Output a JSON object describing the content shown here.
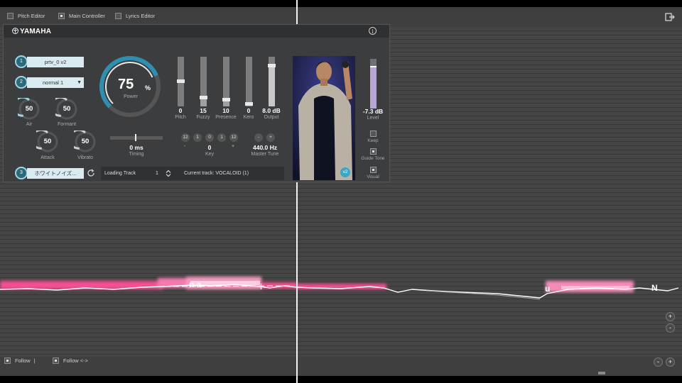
{
  "topbar": {
    "pitch_editor": "Pitch Editor",
    "main_controller": "Main Controller",
    "lyrics_editor": "Lyrics Editor"
  },
  "panel": {
    "brand": "YAMAHA",
    "info_symbol": "i",
    "voice_slot_1": {
      "num": "1",
      "value": "prtv_0 v2"
    },
    "voice_slot_2": {
      "num": "2",
      "value": "normal 1"
    },
    "voice_slot_3": {
      "num": "3",
      "value": "ホワイトノイズ..."
    },
    "knobs": {
      "air": {
        "value": "50",
        "label": "Air"
      },
      "formant": {
        "value": "50",
        "label": "Formant"
      },
      "attack": {
        "value": "50",
        "label": "Attack"
      },
      "vibrato": {
        "value": "50",
        "label": "Vibrato"
      }
    },
    "power": {
      "value": "75",
      "unit": "%",
      "label": "Power",
      "level": 0.75
    },
    "faders": {
      "pitch": {
        "value": "0",
        "label": "Pitch"
      },
      "fuzzy": {
        "value": "15",
        "label": "Fuzzy"
      },
      "presence": {
        "value": "10",
        "label": "Presence"
      },
      "kero": {
        "value": "0",
        "label": "Kero"
      },
      "output": {
        "value": "8.0 dB",
        "label": "Output"
      }
    },
    "timing": {
      "value": "0 ms",
      "label": "Timing"
    },
    "key": {
      "buttons": [
        "12",
        "1",
        "0",
        "1",
        "12"
      ],
      "minus": "-",
      "plus": "+",
      "value": "0",
      "label": "Key"
    },
    "master_tune": {
      "minus": "-",
      "plus": "+",
      "value": "440.0 Hz",
      "label": "Master Tune"
    },
    "loading": {
      "label": "Loading Track",
      "value": "1",
      "current": "Current track: VOCALOID (1)"
    },
    "photo_badge": "v2",
    "level": {
      "value": "-7.3 dB",
      "label": "Level"
    },
    "keep": "Keep",
    "guide_tone": "Guide Tone",
    "visual": "Visual"
  },
  "phonemes": [
    "n a",
    "i",
    "u",
    "N"
  ],
  "bottom": {
    "follow": "Follow",
    "follow_sep": "|",
    "follow2": "Follow <->",
    "zoom_in": "+",
    "zoom_out": "-"
  },
  "colors": {
    "accent": "#3ba6c6",
    "pitch_glow": "#ff6fa8",
    "level": "#b6a6d6"
  }
}
